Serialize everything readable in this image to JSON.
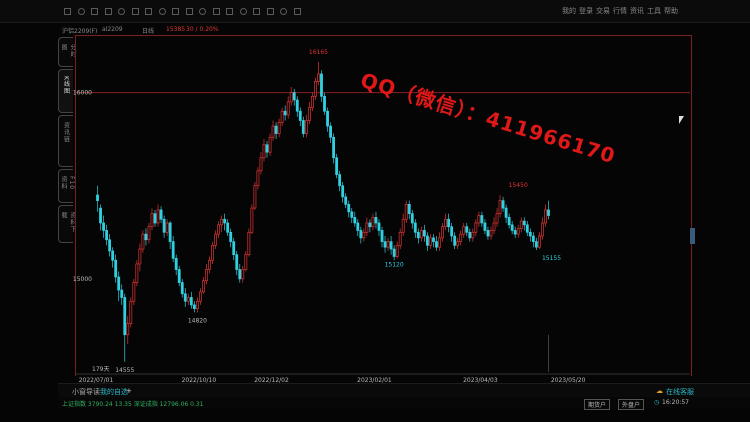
{
  "toolbar": {
    "icons": [
      "back-icon",
      "forward-icon",
      "refresh-icon",
      "home-icon",
      "list-icon",
      "grid-icon",
      "text-icon",
      "chart-icon",
      "draw-icon",
      "ruler-icon",
      "time-icon",
      "f10-icon",
      "settings-icon",
      "star-icon",
      "compare-icon",
      "zoom-icon",
      "circle-icon",
      "fav-icon"
    ],
    "right_texts": [
      "我的",
      "登录",
      "交易",
      "行情",
      "资讯",
      "工具",
      "帮助"
    ]
  },
  "quote": {
    "code": "沪铝2209(F)",
    "contract": "al2209",
    "period": "日线",
    "price": "15385",
    "change": "30 / 0.20%"
  },
  "side_tabs": [
    "分时图",
    "K线图",
    "资讯链",
    "F10资料",
    "资料下载"
  ],
  "chart_data": {
    "type": "candlestick",
    "y_ticks": [
      "16000",
      "15000"
    ],
    "x_ticks": [
      "2022/07/01",
      "2022/10/10",
      "2022/12/02",
      "2023/02/01",
      "2023/04/03",
      "2023/05/20"
    ],
    "annotations": [
      "16165",
      "15450",
      "15120",
      "15155",
      "14820",
      "14555"
    ],
    "bar_count_label": "179天",
    "ylim": [
      14500,
      16250
    ],
    "up_color": "#e03535",
    "down_color": "#30d0e0",
    "candles": [
      [
        15450,
        15420,
        15500,
        15360
      ],
      [
        15380,
        15300,
        15400,
        15260
      ],
      [
        15300,
        15260,
        15340,
        15220
      ],
      [
        15260,
        15210,
        15290,
        15180
      ],
      [
        15210,
        15150,
        15240,
        15120
      ],
      [
        15150,
        15100,
        15170,
        15060
      ],
      [
        15100,
        15010,
        15130,
        14980
      ],
      [
        15010,
        14940,
        15040,
        14880
      ],
      [
        14940,
        14900,
        14970,
        14860
      ],
      [
        14900,
        14700,
        14920,
        14555
      ],
      [
        14700,
        14760,
        14800,
        14650
      ],
      [
        14760,
        14880,
        14900,
        14740
      ],
      [
        14880,
        14980,
        15000,
        14860
      ],
      [
        14980,
        15080,
        15100,
        14960
      ],
      [
        15080,
        15160,
        15190,
        15040
      ],
      [
        15160,
        15240,
        15260,
        15140
      ],
      [
        15240,
        15210,
        15270,
        15180
      ],
      [
        15210,
        15280,
        15300,
        15190
      ],
      [
        15280,
        15350,
        15380,
        15260
      ],
      [
        15350,
        15300,
        15370,
        15280
      ],
      [
        15300,
        15370,
        15400,
        15280
      ],
      [
        15370,
        15320,
        15390,
        15300
      ],
      [
        15320,
        15250,
        15340,
        15220
      ],
      [
        15250,
        15300,
        15320,
        15230
      ],
      [
        15300,
        15200,
        15310,
        15160
      ],
      [
        15200,
        15110,
        15230,
        15090
      ],
      [
        15110,
        15050,
        15130,
        15020
      ],
      [
        15050,
        14980,
        15070,
        14960
      ],
      [
        14980,
        14920,
        15000,
        14900
      ],
      [
        14920,
        14880,
        14950,
        14850
      ],
      [
        14880,
        14900,
        14920,
        14860
      ],
      [
        14900,
        14860,
        14930,
        14840
      ],
      [
        14860,
        14840,
        14880,
        14820
      ],
      [
        14840,
        14880,
        14900,
        14820
      ],
      [
        14880,
        14930,
        14950,
        14860
      ],
      [
        14930,
        14990,
        15010,
        14920
      ],
      [
        14990,
        15050,
        15080,
        14970
      ],
      [
        15050,
        15100,
        15120,
        15030
      ],
      [
        15100,
        15180,
        15200,
        15080
      ],
      [
        15180,
        15240,
        15260,
        15160
      ],
      [
        15240,
        15290,
        15310,
        15220
      ],
      [
        15290,
        15320,
        15340,
        15250
      ],
      [
        15320,
        15300,
        15350,
        15260
      ],
      [
        15300,
        15250,
        15320,
        15230
      ],
      [
        15250,
        15200,
        15270,
        15170
      ],
      [
        15200,
        15130,
        15220,
        15100
      ],
      [
        15130,
        15050,
        15150,
        15020
      ],
      [
        15050,
        15000,
        15080,
        14980
      ],
      [
        15000,
        15050,
        15070,
        14980
      ],
      [
        15050,
        15130,
        15150,
        15040
      ],
      [
        15130,
        15250,
        15270,
        15120
      ],
      [
        15250,
        15380,
        15400,
        15240
      ],
      [
        15380,
        15500,
        15520,
        15370
      ],
      [
        15500,
        15580,
        15600,
        15480
      ],
      [
        15580,
        15650,
        15680,
        15560
      ],
      [
        15650,
        15720,
        15750,
        15630
      ],
      [
        15720,
        15680,
        15740,
        15650
      ],
      [
        15680,
        15760,
        15780,
        15660
      ],
      [
        15760,
        15820,
        15850,
        15740
      ],
      [
        15820,
        15780,
        15840,
        15750
      ],
      [
        15780,
        15840,
        15860,
        15760
      ],
      [
        15840,
        15900,
        15920,
        15820
      ],
      [
        15900,
        15880,
        15930,
        15850
      ],
      [
        15880,
        15950,
        15980,
        15860
      ],
      [
        15950,
        16000,
        16030,
        15930
      ],
      [
        16000,
        15960,
        16020,
        15930
      ],
      [
        15960,
        15900,
        15980,
        15870
      ],
      [
        15900,
        15850,
        15920,
        15820
      ],
      [
        15850,
        15780,
        15870,
        15760
      ],
      [
        15780,
        15850,
        15880,
        15760
      ],
      [
        15850,
        15920,
        15950,
        15830
      ],
      [
        15920,
        15980,
        16000,
        15900
      ],
      [
        15980,
        16060,
        16080,
        15960
      ],
      [
        16060,
        16100,
        16165,
        16040
      ],
      [
        16100,
        15980,
        16120,
        15950
      ],
      [
        15980,
        15900,
        16000,
        15880
      ],
      [
        15900,
        15820,
        15920,
        15790
      ],
      [
        15820,
        15760,
        15840,
        15730
      ],
      [
        15760,
        15650,
        15780,
        15620
      ],
      [
        15650,
        15560,
        15670,
        15540
      ],
      [
        15560,
        15500,
        15580,
        15470
      ],
      [
        15500,
        15440,
        15520,
        15410
      ],
      [
        15440,
        15400,
        15460,
        15380
      ],
      [
        15400,
        15360,
        15420,
        15330
      ],
      [
        15360,
        15330,
        15380,
        15300
      ],
      [
        15330,
        15300,
        15360,
        15280
      ],
      [
        15300,
        15260,
        15320,
        15230
      ],
      [
        15260,
        15220,
        15280,
        15190
      ],
      [
        15220,
        15250,
        15270,
        15200
      ],
      [
        15250,
        15300,
        15330,
        15230
      ],
      [
        15300,
        15280,
        15320,
        15250
      ],
      [
        15280,
        15330,
        15350,
        15260
      ],
      [
        15330,
        15300,
        15360,
        15270
      ],
      [
        15300,
        15260,
        15320,
        15230
      ],
      [
        15260,
        15200,
        15280,
        15170
      ],
      [
        15200,
        15170,
        15230,
        15140
      ],
      [
        15170,
        15200,
        15220,
        15150
      ],
      [
        15200,
        15160,
        15230,
        15130
      ],
      [
        15160,
        15120,
        15180,
        15100
      ],
      [
        15120,
        15180,
        15200,
        15110
      ],
      [
        15180,
        15250,
        15270,
        15160
      ],
      [
        15250,
        15320,
        15350,
        15230
      ],
      [
        15320,
        15400,
        15420,
        15300
      ],
      [
        15400,
        15350,
        15420,
        15320
      ],
      [
        15350,
        15300,
        15370,
        15270
      ],
      [
        15300,
        15250,
        15320,
        15220
      ],
      [
        15250,
        15220,
        15270,
        15190
      ],
      [
        15220,
        15260,
        15280,
        15200
      ],
      [
        15260,
        15230,
        15290,
        15200
      ],
      [
        15230,
        15180,
        15250,
        15150
      ],
      [
        15180,
        15220,
        15240,
        15160
      ],
      [
        15220,
        15200,
        15240,
        15170
      ],
      [
        15200,
        15170,
        15230,
        15150
      ],
      [
        15170,
        15220,
        15250,
        15150
      ],
      [
        15220,
        15280,
        15300,
        15200
      ],
      [
        15280,
        15320,
        15350,
        15260
      ],
      [
        15320,
        15280,
        15350,
        15250
      ],
      [
        15280,
        15230,
        15300,
        15200
      ],
      [
        15230,
        15180,
        15250,
        15160
      ],
      [
        15180,
        15200,
        15220,
        15160
      ],
      [
        15200,
        15240,
        15260,
        15180
      ],
      [
        15240,
        15280,
        15300,
        15220
      ],
      [
        15280,
        15250,
        15300,
        15230
      ],
      [
        15250,
        15220,
        15270,
        15200
      ],
      [
        15220,
        15250,
        15270,
        15200
      ],
      [
        15250,
        15300,
        15320,
        15230
      ],
      [
        15300,
        15340,
        15360,
        15280
      ],
      [
        15340,
        15300,
        15360,
        15280
      ],
      [
        15300,
        15260,
        15320,
        15240
      ],
      [
        15260,
        15230,
        15280,
        15210
      ],
      [
        15230,
        15260,
        15280,
        15210
      ],
      [
        15260,
        15300,
        15330,
        15240
      ],
      [
        15300,
        15350,
        15380,
        15280
      ],
      [
        15350,
        15420,
        15450,
        15330
      ],
      [
        15420,
        15380,
        15440,
        15360
      ],
      [
        15380,
        15330,
        15400,
        15300
      ],
      [
        15330,
        15290,
        15350,
        15270
      ],
      [
        15290,
        15260,
        15310,
        15240
      ],
      [
        15260,
        15240,
        15280,
        15220
      ],
      [
        15240,
        15270,
        15290,
        15220
      ],
      [
        15270,
        15310,
        15330,
        15250
      ],
      [
        15310,
        15290,
        15330,
        15260
      ],
      [
        15290,
        15250,
        15310,
        15230
      ],
      [
        15250,
        15230,
        15270,
        15200
      ],
      [
        15230,
        15200,
        15250,
        15170
      ],
      [
        15200,
        15170,
        15220,
        15155
      ],
      [
        15170,
        15230,
        15250,
        15160
      ],
      [
        15230,
        15300,
        15330,
        15210
      ],
      [
        15300,
        15370,
        15400,
        15280
      ],
      [
        15370,
        15340,
        15420,
        15320
      ]
    ]
  },
  "watermark": "QQ（微信）：411966170",
  "bottom_tabs": [
    "小窗导读",
    "我的自选",
    "+"
  ],
  "bottom_right": [
    "在线客服"
  ],
  "status": {
    "left": "上证指数 3790.24 13.35    深证成指 12796.06 0.31",
    "btn1": "期货户",
    "btn2": "外盘户",
    "time": "16:20:57"
  }
}
